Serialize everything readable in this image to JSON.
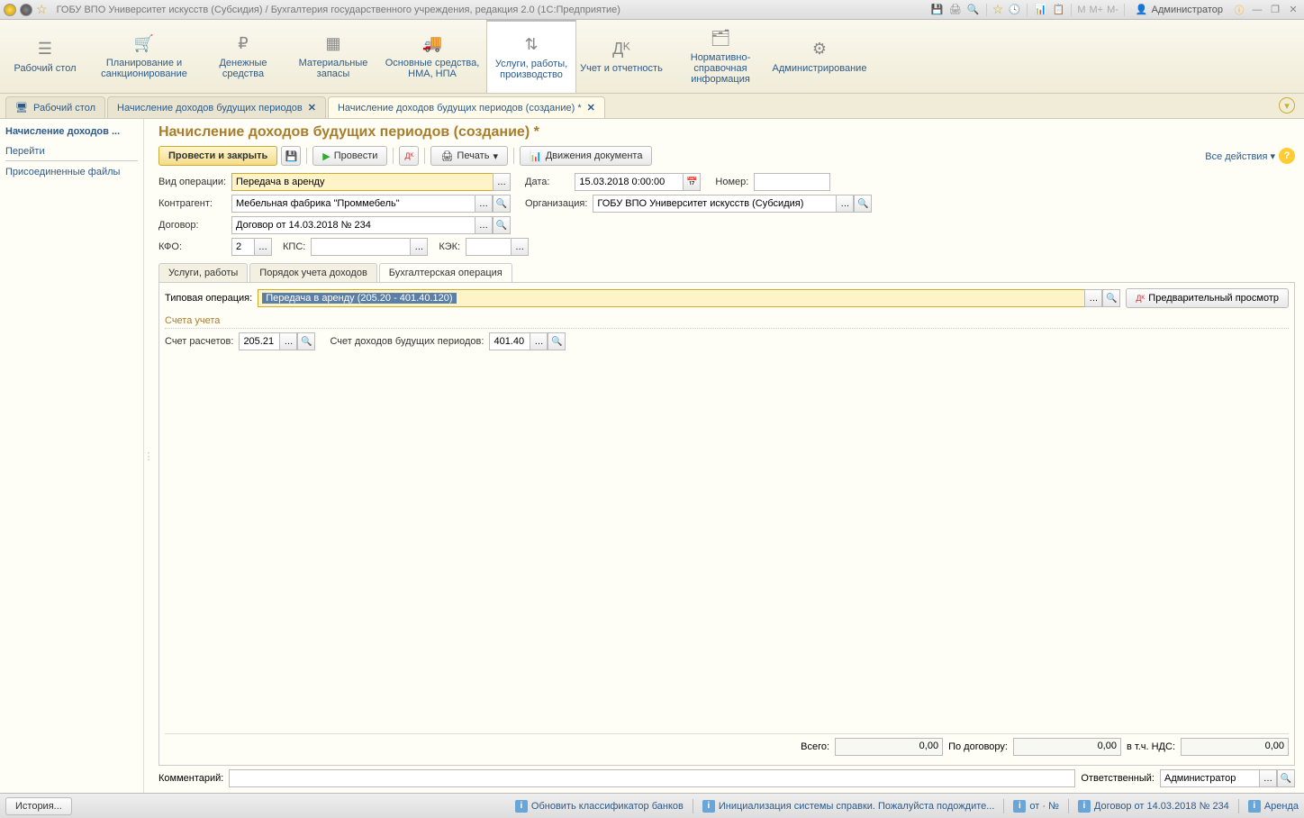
{
  "titlebar": {
    "title": "ГОБУ ВПО Университет искусств (Субсидия) / Бухгалтерия государственного учреждения, редакция 2.0  (1С:Предприятие)",
    "user": "Администратор",
    "m_labels": [
      "M",
      "M+",
      "M-"
    ]
  },
  "mainnav": [
    {
      "label": "Рабочий стол"
    },
    {
      "label": "Планирование и санкционирование"
    },
    {
      "label": "Денежные средства"
    },
    {
      "label": "Материальные запасы"
    },
    {
      "label": "Основные средства, НМА, НПА"
    },
    {
      "label": "Услуги, работы, производство"
    },
    {
      "label": "Учет и отчетность"
    },
    {
      "label": "Нормативно-справочная информация"
    },
    {
      "label": "Администрирование"
    }
  ],
  "tabs": [
    {
      "label": "Рабочий стол"
    },
    {
      "label": "Начисление доходов будущих периодов"
    },
    {
      "label": "Начисление доходов будущих периодов (создание) *"
    }
  ],
  "leftpanel": {
    "title": "Начисление доходов ...",
    "section": "Перейти",
    "links": [
      "Присоединенные файлы"
    ]
  },
  "page": {
    "title": "Начисление доходов будущих периодов (создание) *",
    "toolbar": {
      "post_close": "Провести и закрыть",
      "post": "Провести",
      "print": "Печать",
      "movements": "Движения документа",
      "all_actions": "Все действия"
    }
  },
  "form": {
    "operation_type_label": "Вид операции:",
    "operation_type": "Передача в аренду",
    "date_label": "Дата:",
    "date": "15.03.2018  0:00:00",
    "number_label": "Номер:",
    "number": "",
    "counterparty_label": "Контрагент:",
    "counterparty": "Мебельная фабрика \"Проммебель\"",
    "organization_label": "Организация:",
    "organization": "ГОБУ ВПО Университет искусств (Субсидия)",
    "contract_label": "Договор:",
    "contract": "Договор от 14.03.2018 № 234",
    "kfo_label": "КФО:",
    "kfo": "2",
    "kps_label": "КПС:",
    "kps": "",
    "kek_label": "КЭК:",
    "kek": ""
  },
  "inner_tabs": [
    "Услуги, работы",
    "Порядок учета доходов",
    "Бухгалтерская операция"
  ],
  "accounting": {
    "typical_op_label": "Типовая операция:",
    "typical_op": "Передача в аренду (205.20 - 401.40.120)",
    "preview": "Предварительный просмотр",
    "accounts_title": "Счета учета",
    "settlement_label": "Счет расчетов:",
    "settlement": "205.21",
    "future_income_label": "Счет доходов будущих периодов:",
    "future_income": "401.40"
  },
  "totals": {
    "total_label": "Всего:",
    "total": "0,00",
    "by_contract_label": "По договору:",
    "by_contract": "0,00",
    "vat_label": "в т.ч. НДС:",
    "vat": "0,00"
  },
  "footer": {
    "comment_label": "Комментарий:",
    "comment": "",
    "responsible_label": "Ответственный:",
    "responsible": "Администратор"
  },
  "statusbar": {
    "history": "История...",
    "update_banks": "Обновить классификатор банков",
    "init_help": "Инициализация системы справки. Пожалуйста подождите...",
    "link1": "от · №",
    "link2": "Договор от 14.03.2018 № 234",
    "link3": "Аренда"
  }
}
